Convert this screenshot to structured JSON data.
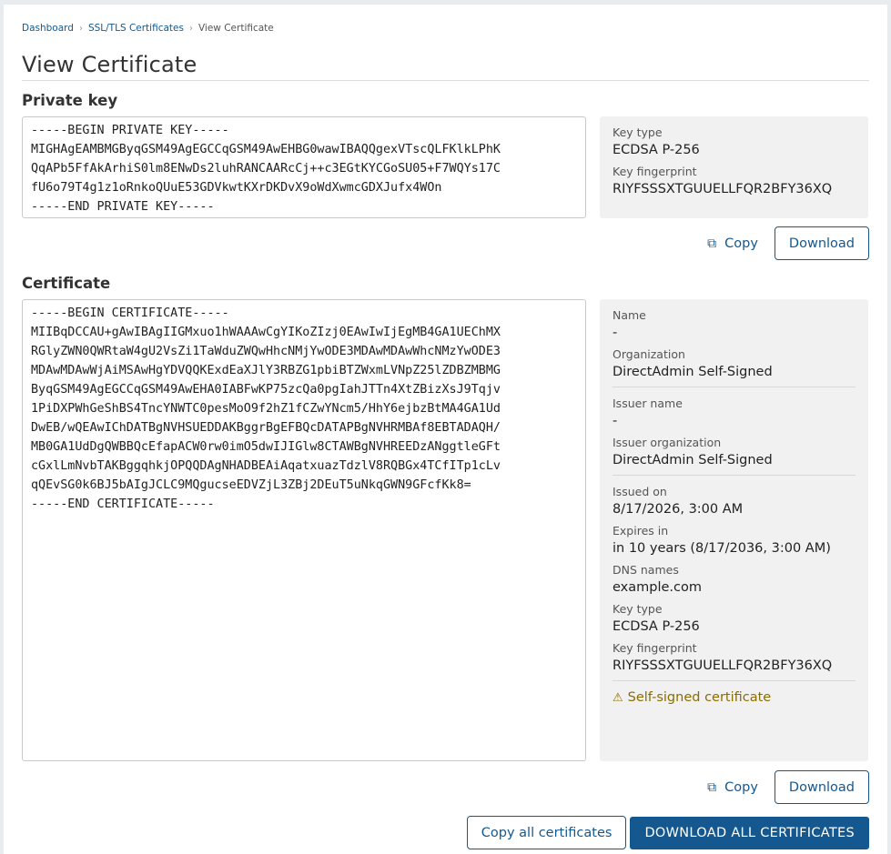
{
  "breadcrumb": {
    "items": [
      "Dashboard",
      "SSL/TLS Certificates",
      "View Certificate"
    ]
  },
  "page": {
    "title": "View Certificate"
  },
  "private_key": {
    "section_title": "Private key",
    "pem": "-----BEGIN PRIVATE KEY-----\nMIGHAgEAMBMGByqGSM49AgEGCCqGSM49AwEHBG0wawIBAQQgexVTscQLFKlkLPhK\nQqAPb5FfAkArhiS0lm8ENwDs2luhRANCAARcCj++c3EGtKYCGoSU05+F7WQYs17C\nfU6o79T4g1z1oRnkoQUuE53GDVkwtKXrDKDvX9oWdXwmcGDXJufx4WOn\n-----END PRIVATE KEY-----",
    "info": {
      "key_type_label": "Key type",
      "key_type": "ECDSA P-256",
      "fingerprint_label": "Key fingerprint",
      "fingerprint": "RIYFSSSXTGUUELLFQR2BFY36XQ"
    },
    "copy_label": "Copy",
    "download_label": "Download"
  },
  "certificate": {
    "section_title": "Certificate",
    "pem": "-----BEGIN CERTIFICATE-----\nMIIBqDCCAU+gAwIBAgIIGMxuo1hWAAAwCgYIKoZIzj0EAwIwIjEgMB4GA1UEChMX\nRGlyZWN0QWRtaW4gU2VsZi1TaWduZWQwHhcNMjYwODE3MDAwMDAwWhcNMzYwODE3\nMDAwMDAwWjAiMSAwHgYDVQQKExdEaXJlY3RBZG1pbiBTZWxmLVNpZ25lZDBZMBMG\nByqGSM49AgEGCCqGSM49AwEHA0IABFwKP75zcQa0pgIahJTTn4XtZBizXsJ9Tqjv\n1PiDXPWhGeShBS4TncYNWTC0pesMoO9f2hZ1fCZwYNcm5/HhY6ejbzBtMA4GA1Ud\nDwEB/wQEAwIChDATBgNVHSUEDDAKBggrBgEFBQcDATAPBgNVHRMBAf8EBTADAQH/\nMB0GA1UdDgQWBBQcEfapACW0rw0imO5dwIJIGlw8CTAWBgNVHREEDzANggtleGFt\ncGxlLmNvbTAKBggqhkjOPQQDAgNHADBEAiAqatxuazTdzlV8RQBGx4TCfITp1cLv\nqQEvSG0k6BJ5bAIgJCLC9MQgucseEDVZjL3ZBj2DEuT5uNkqGWN9GFcfKk8=\n-----END CERTIFICATE-----",
    "info": {
      "name_label": "Name",
      "name": "-",
      "org_label": "Organization",
      "org": "DirectAdmin Self-Signed",
      "issuer_name_label": "Issuer name",
      "issuer_name": "-",
      "issuer_org_label": "Issuer organization",
      "issuer_org": "DirectAdmin Self-Signed",
      "issued_label": "Issued on",
      "issued": "8/17/2026, 3:00 AM",
      "expires_label": "Expires in",
      "expires": "in 10 years (8/17/2036, 3:00 AM)",
      "dns_label": "DNS names",
      "dns": "example.com",
      "key_type_label": "Key type",
      "key_type": "ECDSA P-256",
      "fingerprint_label": "Key fingerprint",
      "fingerprint": "RIYFSSSXTGUUELLFQR2BFY36XQ",
      "warning": "Self-signed certificate"
    },
    "copy_label": "Copy",
    "download_label": "Download"
  },
  "footer": {
    "copy_all_label": "Copy all certificates",
    "download_all_label": "DOWNLOAD ALL CERTIFICATES"
  },
  "colors": {
    "accent": "#14588f",
    "warning": "#8a6d00",
    "panel": "#f1f1f1"
  },
  "icons": {
    "breadcrumb_sep": "chevron-right-icon",
    "copy": "clipboard-icon",
    "warning": "warning-triangle-icon"
  }
}
